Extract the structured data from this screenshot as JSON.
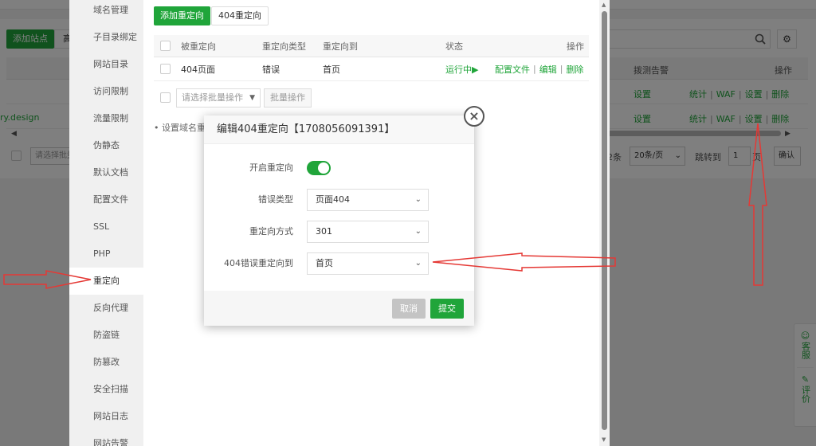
{
  "background": {
    "add_site_label": "添加站点",
    "second_button_label": "高",
    "site_name": "ry.design",
    "column_headers": {
      "alert": "拨测告警",
      "actions": "操作"
    },
    "rows": [
      {
        "setting": "设置",
        "actions": [
          "统计",
          "WAF",
          "设置",
          "删除"
        ]
      },
      {
        "setting": "设置",
        "actions": [
          "统计",
          "WAF",
          "设置",
          "删除"
        ]
      }
    ],
    "footer": {
      "batch_placeholder": "请选择批量",
      "count_suffix": "2条",
      "page_size": "20条/页",
      "goto_label": "跳转到",
      "goto_value": "1",
      "page_suffix": "页",
      "confirm": "确认"
    },
    "float_panel": {
      "service": "客服",
      "review": "评价"
    }
  },
  "layer": {
    "nav_items": [
      "域名管理",
      "子目录绑定",
      "网站目录",
      "访问限制",
      "流量限制",
      "伪静态",
      "默认文档",
      "配置文件",
      "SSL",
      "PHP",
      "重定向",
      "反向代理",
      "防盗链",
      "防篡改",
      "安全扫描",
      "网站日志",
      "网站告警"
    ],
    "active_nav": "重定向",
    "tabs": {
      "add_redirect": "添加重定向",
      "redirect_404": "404重定向"
    },
    "table": {
      "headers": {
        "source": "被重定向",
        "type": "重定向类型",
        "target": "重定向到",
        "status": "状态",
        "actions": "操作"
      },
      "rows": [
        {
          "source": "404页面",
          "type": "错误",
          "target": "首页",
          "status": "运行中▶",
          "actions": [
            "配置文件",
            "编辑",
            "删除"
          ]
        }
      ]
    },
    "batch": {
      "placeholder": "请选择批量操作",
      "button": "批量操作"
    },
    "tip": "设置域名重"
  },
  "dialog": {
    "title": "编辑404重定向【1708056091391】",
    "fields": {
      "enable_label": "开启重定向",
      "enable_value": true,
      "error_type_label": "错误类型",
      "error_type_value": "页面404",
      "method_label": "重定向方式",
      "method_value": "301",
      "target_label": "404错误重定向到",
      "target_value": "首页"
    },
    "cancel_label": "取消",
    "submit_label": "提交"
  },
  "colors": {
    "brand": "#20a53a",
    "annotation": "#e53935"
  }
}
